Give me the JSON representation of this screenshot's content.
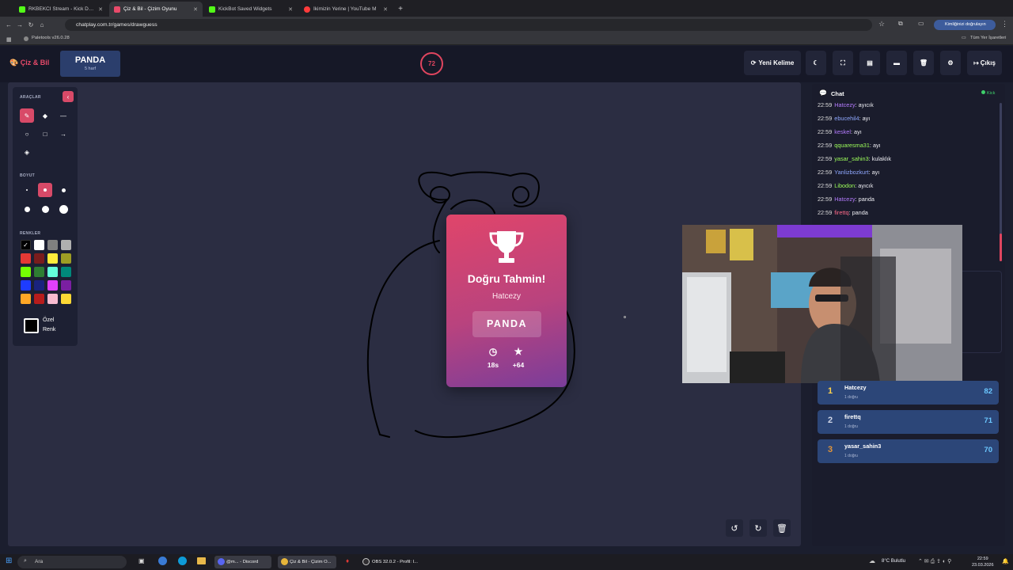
{
  "browser": {
    "tabs": [
      {
        "title": "RKBEKCI Stream - Kick Dashboa",
        "color": "#53fc18"
      },
      {
        "title": "Çiz & Bil - Çizim Oyunu",
        "color": "#e84a6a"
      },
      {
        "title": "KickBot Saved Widgets",
        "color": "#53fc18"
      },
      {
        "title": "İkimizin Yerine | YouTube M",
        "color": "#ff3b3b"
      }
    ],
    "url": "chatplay.com.tr/games/drawguess",
    "profile_label": "Kimliğinizi doğrulayın",
    "bookmark": "Paletools v26.0.28",
    "all_bookmarks": "Tüm Yer İşaretleri"
  },
  "header": {
    "logo": "Çiz & Bil",
    "word": "PANDA",
    "word_sub": "5 harf",
    "timer": "72",
    "new_word": "Yeni Kelime",
    "logout": "Çıkış"
  },
  "tools": {
    "tools_label": "ARAÇLAR",
    "size_label": "BOYUT",
    "colors_label": "RENKLER",
    "custom_color_1": "Özel",
    "custom_color_2": "Renk",
    "palette": [
      "#000000",
      "#ffffff",
      "#808080",
      "#b0b0b0",
      "#e53935",
      "#7a1c1c",
      "#ffeb3b",
      "#9e9d24",
      "#76ff03",
      "#2e7d32",
      "#64ffda",
      "#00897b",
      "#1e3cff",
      "#1a237e",
      "#e040fb",
      "#7b1fa2",
      "#ffa726",
      "#b71c1c",
      "#f8bbd0",
      "#fdd835"
    ]
  },
  "modal": {
    "title": "Doğru Tahmin!",
    "name": "Hatcezy",
    "word": "PANDA",
    "time": "18s",
    "points": "+64"
  },
  "chat": {
    "title": "Chat",
    "platform": "Kick",
    "messages": [
      {
        "time": "22:59",
        "user": "Hatcezy",
        "color": "#b57cff",
        "text": ": ayıcık"
      },
      {
        "time": "22:59",
        "user": "ebucehil4",
        "color": "#8fa8ff",
        "text": ": ayı"
      },
      {
        "time": "22:59",
        "user": "keskel",
        "color": "#b57cff",
        "text": ": ayı"
      },
      {
        "time": "22:59",
        "user": "qquaresma31",
        "color": "#9dff5a",
        "text": ": ayı"
      },
      {
        "time": "22:59",
        "user": "yasar_sahin3",
        "color": "#9dff5a",
        "text": ": kulaklık"
      },
      {
        "time": "22:59",
        "user": "Yanlizbozkurt",
        "color": "#8fa8ff",
        "text": ": ayı"
      },
      {
        "time": "22:59",
        "user": "Libodon",
        "color": "#9dff5a",
        "text": ": ayıcık"
      },
      {
        "time": "22:59",
        "user": "Hatcezy",
        "color": "#b57cff",
        "text": ": panda"
      },
      {
        "time": "22:59",
        "user": "firettq",
        "color": "#ff6b8a",
        "text": ": panda"
      }
    ]
  },
  "leaderboard": [
    {
      "rank": "1",
      "name": "Hatcezy",
      "correct": "1 doğru",
      "points": "82",
      "rank_color": "#ffd34d"
    },
    {
      "rank": "2",
      "name": "firettq",
      "correct": "1 doğru",
      "points": "71",
      "rank_color": "#d0d6e6"
    },
    {
      "rank": "3",
      "name": "yasar_sahin3",
      "correct": "1 doğru",
      "points": "70",
      "rank_color": "#e0943a"
    }
  ],
  "taskbar": {
    "search": "Ara",
    "discord": "@m... - Discord",
    "chrome": "Çiz & Bil - Çizim O...",
    "obs": "OBS 32.0.2 - Profil: I...",
    "weather": "8°C  Bulutlu",
    "time": "22:59",
    "date": "23.03.2026"
  }
}
